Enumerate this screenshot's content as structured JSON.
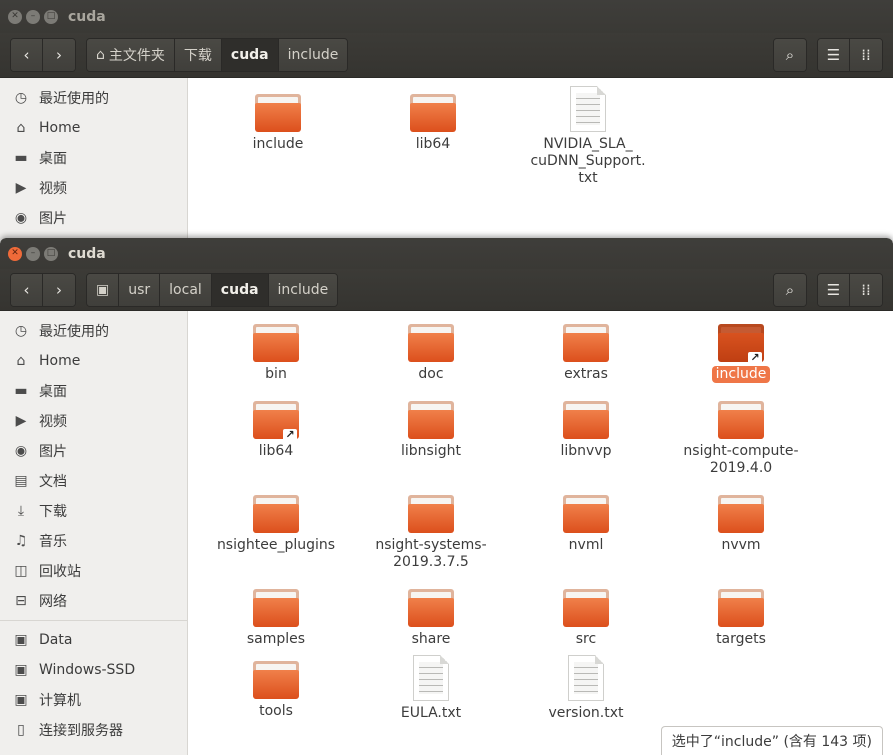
{
  "window1": {
    "title": "cuda",
    "breadcrumb": [
      "主文件夹",
      "下载",
      "cuda",
      "include"
    ],
    "active_crumb": "cuda",
    "sidebar": [
      {
        "icon": "clock-icon",
        "label": "最近使用的"
      },
      {
        "icon": "home-icon",
        "label": "Home"
      },
      {
        "icon": "folder-icon",
        "label": "桌面"
      },
      {
        "icon": "video-icon",
        "label": "视频"
      },
      {
        "icon": "camera-icon",
        "label": "图片"
      }
    ],
    "items": [
      {
        "label": "include",
        "type": "folder"
      },
      {
        "label": "lib64",
        "type": "folder"
      },
      {
        "label": "NVIDIA_SLA_\ncuDNN_Support.\ntxt",
        "type": "file"
      }
    ]
  },
  "window2": {
    "title": "cuda",
    "breadcrumb": [
      "usr",
      "local",
      "cuda",
      "include"
    ],
    "active_crumb": "cuda",
    "sidebar": [
      {
        "icon": "clock-icon",
        "label": "最近使用的"
      },
      {
        "icon": "home-icon",
        "label": "Home"
      },
      {
        "icon": "folder-icon",
        "label": "桌面"
      },
      {
        "icon": "video-icon",
        "label": "视频"
      },
      {
        "icon": "camera-icon",
        "label": "图片"
      },
      {
        "icon": "document-icon",
        "label": "文档"
      },
      {
        "icon": "download-icon",
        "label": "下载"
      },
      {
        "icon": "music-icon",
        "label": "音乐"
      },
      {
        "icon": "trash-icon",
        "label": "回收站"
      },
      {
        "icon": "network-icon",
        "label": "网络"
      }
    ],
    "devices": [
      {
        "icon": "drive-icon",
        "label": "Data"
      },
      {
        "icon": "drive-icon",
        "label": "Windows-SSD"
      },
      {
        "icon": "computer-icon",
        "label": "计算机"
      },
      {
        "icon": "connect-server-icon",
        "label": "连接到服务器"
      }
    ],
    "items": [
      {
        "label": "bin",
        "type": "folder"
      },
      {
        "label": "doc",
        "type": "folder"
      },
      {
        "label": "extras",
        "type": "folder"
      },
      {
        "label": "include",
        "type": "folder-link",
        "selected": true
      },
      {
        "label": "lib64",
        "type": "folder-link"
      },
      {
        "label": "libnsight",
        "type": "folder"
      },
      {
        "label": "libnvvp",
        "type": "folder"
      },
      {
        "label": "nsight-compute-\n2019.4.0",
        "type": "folder"
      },
      {
        "label": "nsightee_plugins",
        "type": "folder"
      },
      {
        "label": "nsight-systems-\n2019.3.7.5",
        "type": "folder"
      },
      {
        "label": "nvml",
        "type": "folder"
      },
      {
        "label": "nvvm",
        "type": "folder"
      },
      {
        "label": "samples",
        "type": "folder"
      },
      {
        "label": "share",
        "type": "folder"
      },
      {
        "label": "src",
        "type": "folder"
      },
      {
        "label": "targets",
        "type": "folder"
      },
      {
        "label": "tools",
        "type": "folder"
      },
      {
        "label": "EULA.txt",
        "type": "file"
      },
      {
        "label": "version.txt",
        "type": "file"
      }
    ],
    "status": "选中了“include” (含有 143 项)"
  },
  "colors": {
    "accent": "#ef7647",
    "folder": "#e8663a",
    "titlebar": "#3c3b37"
  }
}
